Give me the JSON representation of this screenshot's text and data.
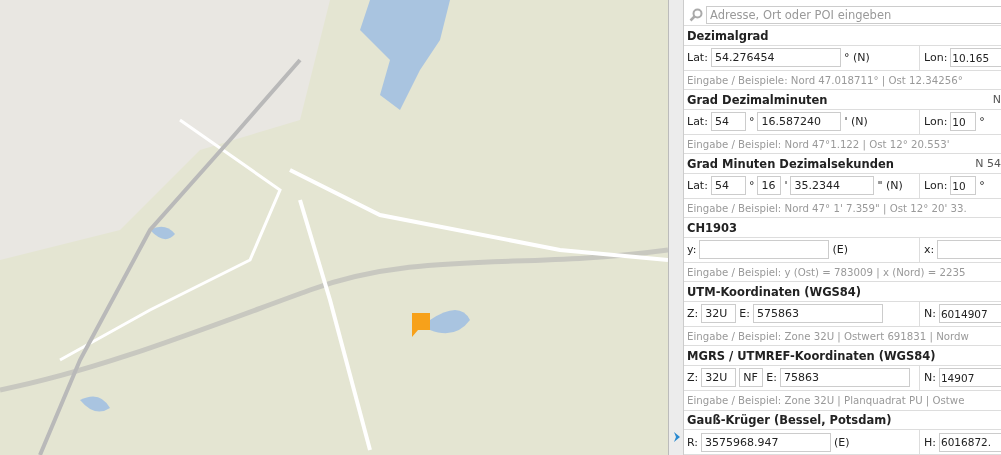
{
  "search": {
    "placeholder": "Adresse, Ort oder POI eingeben"
  },
  "sections": [
    {
      "title": "Dezimalgrad",
      "left": [
        {
          "kind": "text",
          "text": "Lat:"
        },
        {
          "kind": "long",
          "value": "54.276454"
        },
        {
          "kind": "text",
          "text": "° (N)"
        }
      ],
      "right": [
        {
          "kind": "text",
          "text": "Lon:"
        },
        {
          "kind": "long",
          "value": "10.165"
        }
      ],
      "hint": "Eingabe / Beispiele: Nord 47.018711° | Ost 12.34256°"
    },
    {
      "title": "Grad Dezimalminuten",
      "extra": "N",
      "left": [
        {
          "kind": "text",
          "text": "Lat:"
        },
        {
          "kind": "short",
          "value": "54"
        },
        {
          "kind": "text",
          "text": "°"
        },
        {
          "kind": "medium",
          "value": "16.587240"
        },
        {
          "kind": "text",
          "text": "' (N)"
        }
      ],
      "right": [
        {
          "kind": "text",
          "text": "Lon:"
        },
        {
          "kind": "short",
          "value": "10"
        },
        {
          "kind": "text",
          "text": "°"
        }
      ],
      "hint": "Eingabe / Beispiel: Nord 47°1.122 | Ost 12° 20.553'"
    },
    {
      "title": "Grad Minuten Dezimalsekunden",
      "extra": "N 54",
      "left": [
        {
          "kind": "text",
          "text": "Lat:"
        },
        {
          "kind": "short",
          "value": "54"
        },
        {
          "kind": "text",
          "text": "°"
        },
        {
          "kind": "tiny",
          "value": "16"
        },
        {
          "kind": "text",
          "text": "'"
        },
        {
          "kind": "medium",
          "value": "35.2344"
        },
        {
          "kind": "text",
          "text": "\" (N)"
        }
      ],
      "right": [
        {
          "kind": "text",
          "text": "Lon:"
        },
        {
          "kind": "short",
          "value": "10"
        },
        {
          "kind": "text",
          "text": "°"
        }
      ],
      "hint": "Eingabe / Beispiel: Nord 47° 1' 7.359\" | Ost 12° 20' 33."
    },
    {
      "title": "CH1903",
      "left": [
        {
          "kind": "text",
          "text": "y:"
        },
        {
          "kind": "long"
        },
        {
          "kind": "text",
          "text": "(E)"
        }
      ],
      "right": [
        {
          "kind": "text",
          "text": "x:"
        },
        {
          "kind": "long"
        }
      ],
      "hint": "Eingabe / Beispiel: y (Ost) = 783009 | x (Nord) = 2235"
    },
    {
      "title": "UTM-Koordinaten (WGS84)",
      "left": [
        {
          "kind": "text",
          "text": "Z:"
        },
        {
          "kind": "short",
          "value": "32U"
        },
        {
          "kind": "text",
          "text": "E:"
        },
        {
          "kind": "long",
          "value": "575863"
        }
      ],
      "right": [
        {
          "kind": "text",
          "text": "N:"
        },
        {
          "kind": "long",
          "value": "6014907"
        }
      ],
      "hint": "Eingabe / Beispiel: Zone 32U | Ostwert 691831 | Nordw"
    },
    {
      "title": "MGRS / UTMREF-Koordinaten (WGS84)",
      "left": [
        {
          "kind": "text",
          "text": "Z:"
        },
        {
          "kind": "short",
          "value": "32U"
        },
        {
          "kind": "tiny",
          "value": "NF"
        },
        {
          "kind": "text",
          "text": "E:"
        },
        {
          "kind": "long",
          "value": "75863"
        }
      ],
      "right": [
        {
          "kind": "text",
          "text": "N:"
        },
        {
          "kind": "long",
          "value": "14907"
        }
      ],
      "hint": "Eingabe / Beispiel: Zone 32U | Planquadrat PU | Ostwe"
    },
    {
      "title": "Gauß-Krüger (Bessel, Potsdam)",
      "left": [
        {
          "kind": "text",
          "text": "R:"
        },
        {
          "kind": "long",
          "value": "3575968.947"
        },
        {
          "kind": "text",
          "text": "(E)"
        }
      ],
      "right": [
        {
          "kind": "text",
          "text": "H:"
        },
        {
          "kind": "long",
          "value": "6016872."
        }
      ]
    }
  ]
}
